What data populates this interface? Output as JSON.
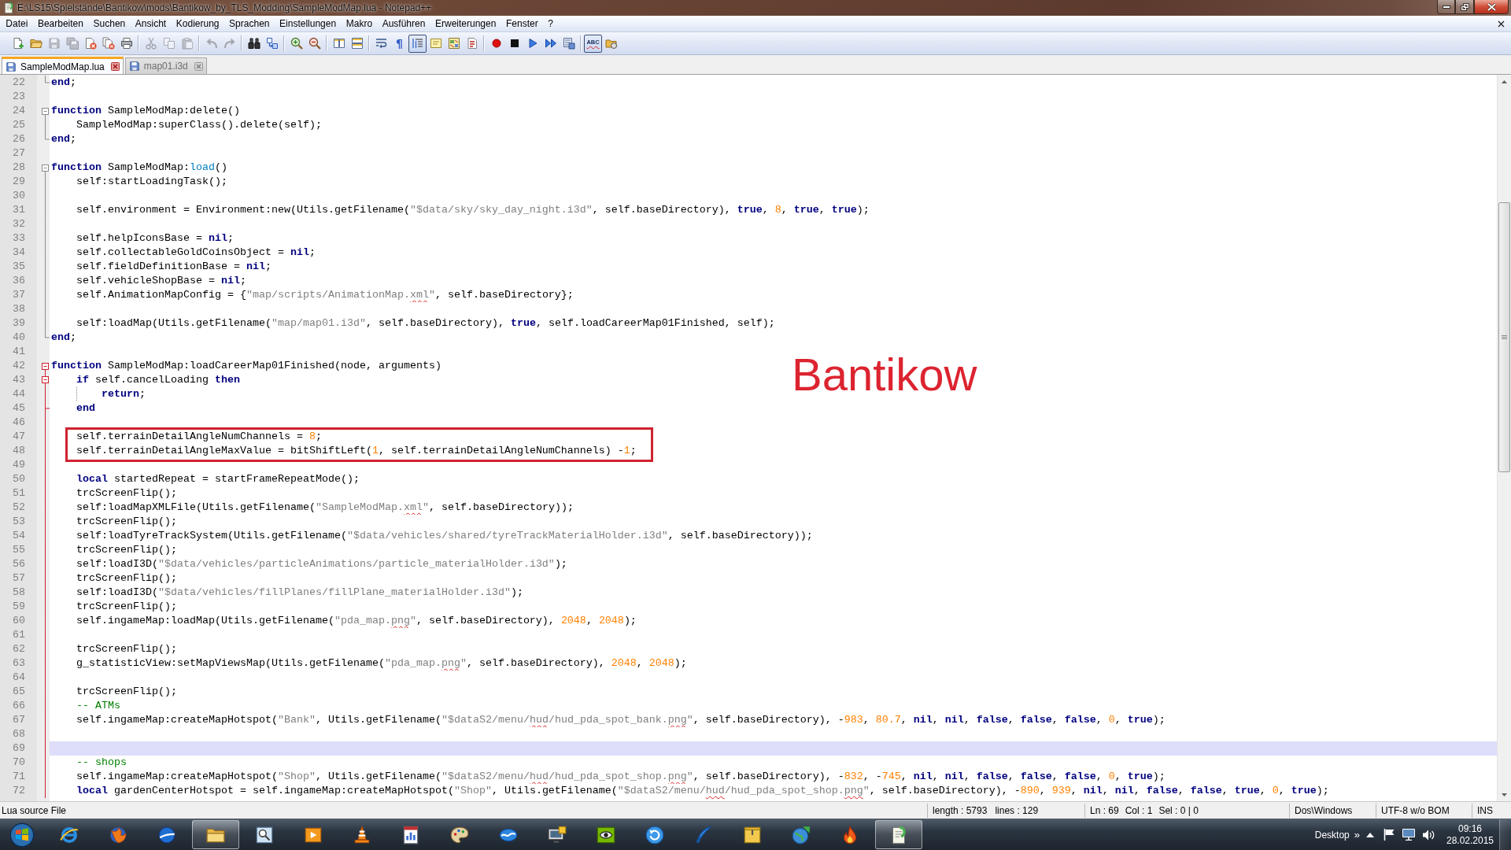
{
  "window": {
    "title": "E:\\LS15\\Spielstände\\Bantikow\\mods\\Bantikow_by_TLS_Modding\\SampleModMap.lua - Notepad++"
  },
  "menu": [
    "Datei",
    "Bearbeiten",
    "Suchen",
    "Ansicht",
    "Kodierung",
    "Sprachen",
    "Einstellungen",
    "Makro",
    "Ausführen",
    "Erweiterungen",
    "Fenster",
    "?"
  ],
  "toolbar": {
    "groups": [
      [
        {
          "kind": "new",
          "on": false,
          "disabled": false
        },
        {
          "kind": "open",
          "on": false,
          "disabled": false
        },
        {
          "kind": "save",
          "on": false,
          "disabled": true
        },
        {
          "kind": "saveall",
          "on": false,
          "disabled": true
        },
        {
          "kind": "close",
          "on": false,
          "disabled": false
        },
        {
          "kind": "closeall",
          "on": false,
          "disabled": false
        },
        {
          "kind": "print",
          "on": false,
          "disabled": false
        }
      ],
      [
        {
          "kind": "cut",
          "on": false,
          "disabled": true
        },
        {
          "kind": "copy",
          "on": false,
          "disabled": true
        },
        {
          "kind": "paste",
          "on": false,
          "disabled": true
        }
      ],
      [
        {
          "kind": "undo",
          "on": false,
          "disabled": true
        },
        {
          "kind": "redo",
          "on": false,
          "disabled": true
        }
      ],
      [
        {
          "kind": "find",
          "on": false,
          "disabled": false
        },
        {
          "kind": "replace",
          "on": false,
          "disabled": false
        }
      ],
      [
        {
          "kind": "zoomin",
          "on": false,
          "disabled": false
        },
        {
          "kind": "zoomout",
          "on": false,
          "disabled": false
        }
      ],
      [
        {
          "kind": "syncv",
          "on": false,
          "disabled": false
        },
        {
          "kind": "synch",
          "on": false,
          "disabled": false
        }
      ],
      [
        {
          "kind": "wrap",
          "on": false,
          "disabled": false
        },
        {
          "kind": "glyph",
          "glyph": "¶",
          "on": false,
          "disabled": false
        },
        {
          "kind": "indentguide",
          "on": true,
          "disabled": false
        },
        {
          "kind": "udl",
          "on": false,
          "disabled": false
        },
        {
          "kind": "docmap",
          "on": false,
          "disabled": false
        },
        {
          "kind": "funclist",
          "on": false,
          "disabled": false
        }
      ],
      [
        {
          "kind": "record",
          "on": false,
          "disabled": false
        },
        {
          "kind": "stop",
          "on": false,
          "disabled": false
        },
        {
          "kind": "play",
          "on": false,
          "disabled": false
        },
        {
          "kind": "playmulti",
          "on": false,
          "disabled": false
        },
        {
          "kind": "savemacro",
          "on": false,
          "disabled": false
        }
      ],
      [
        {
          "kind": "spell",
          "label": "ABC",
          "on": true,
          "disabled": false
        },
        {
          "kind": "spellfolder",
          "on": false,
          "disabled": false
        }
      ]
    ]
  },
  "tabs": [
    {
      "label": "SampleModMap.lua",
      "selected": true
    },
    {
      "label": "map01.i3d",
      "selected": false
    }
  ],
  "editor": {
    "lines": [
      {
        "number": "22",
        "kind": "tail",
        "fold_active": false,
        "current": false,
        "boxed": false,
        "indent_guide": false,
        "segments": [
          {
            "kind": "keyword",
            "text": "end"
          },
          {
            "kind": "plain",
            "text": ";"
          }
        ]
      },
      {
        "number": "23",
        "kind": "none",
        "current": false,
        "boxed": false,
        "indent_guide": false
      },
      {
        "number": "24",
        "kind": "head",
        "fold_active": false,
        "current": false,
        "boxed": false,
        "indent_guide": false,
        "segments": [
          {
            "kind": "keyword",
            "text": "function"
          },
          {
            "kind": "plain",
            "text": " SampleModMap:delete()"
          }
        ]
      },
      {
        "number": "25",
        "kind": "body",
        "fold_active": false,
        "current": false,
        "boxed": false,
        "indent_guide": false,
        "segments": [
          {
            "kind": "plain",
            "text": "    SampleModMap:superClass().delete(self);"
          }
        ]
      },
      {
        "number": "26",
        "kind": "tail",
        "fold_active": false,
        "current": false,
        "boxed": false,
        "indent_guide": false,
        "segments": [
          {
            "kind": "keyword",
            "text": "end"
          },
          {
            "kind": "plain",
            "text": ";"
          }
        ]
      },
      {
        "number": "27",
        "kind": "none",
        "current": false,
        "boxed": false,
        "indent_guide": false
      },
      {
        "number": "28",
        "kind": "head",
        "fold_active": false,
        "current": false,
        "boxed": false,
        "indent_guide": false,
        "segments": [
          {
            "kind": "keyword",
            "text": "function"
          },
          {
            "kind": "plain",
            "text": " SampleModMap:"
          },
          {
            "kind": "builtin",
            "text": "load"
          },
          {
            "kind": "plain",
            "text": "()"
          }
        ]
      },
      {
        "number": "29",
        "kind": "body",
        "fold_active": false,
        "current": false,
        "boxed": false,
        "indent_guide": false,
        "segments": [
          {
            "kind": "plain",
            "text": "    self:startLoadingTask();"
          }
        ]
      },
      {
        "number": "30",
        "kind": "body",
        "fold_active": false,
        "current": false,
        "boxed": false,
        "indent_guide": false
      },
      {
        "number": "31",
        "kind": "body",
        "fold_active": false,
        "current": false,
        "boxed": false,
        "indent_guide": false,
        "segments": [
          {
            "kind": "plain",
            "text": "    self.environment = Environment:new(Utils.getFilename("
          },
          {
            "kind": "string",
            "text": "\"$data/sky/sky_day_night.i3d\""
          },
          {
            "kind": "plain",
            "text": ", self.baseDirectory), "
          },
          {
            "kind": "keyword",
            "text": "true"
          },
          {
            "kind": "plain",
            "text": ", "
          },
          {
            "kind": "number",
            "text": "8"
          },
          {
            "kind": "plain",
            "text": ", "
          },
          {
            "kind": "keyword",
            "text": "true"
          },
          {
            "kind": "plain",
            "text": ", "
          },
          {
            "kind": "keyword",
            "text": "true"
          },
          {
            "kind": "plain",
            "text": ");"
          }
        ]
      },
      {
        "number": "32",
        "kind": "body",
        "fold_active": false,
        "current": false,
        "boxed": false,
        "indent_guide": false
      },
      {
        "number": "33",
        "kind": "body",
        "fold_active": false,
        "current": false,
        "boxed": false,
        "indent_guide": false,
        "segments": [
          {
            "kind": "plain",
            "text": "    self.helpIconsBase = "
          },
          {
            "kind": "keyword",
            "text": "nil"
          },
          {
            "kind": "plain",
            "text": ";"
          }
        ]
      },
      {
        "number": "34",
        "kind": "body",
        "fold_active": false,
        "current": false,
        "boxed": false,
        "indent_guide": false,
        "segments": [
          {
            "kind": "plain",
            "text": "    self.collectableGoldCoinsObject = "
          },
          {
            "kind": "keyword",
            "text": "nil"
          },
          {
            "kind": "plain",
            "text": ";"
          }
        ]
      },
      {
        "number": "35",
        "kind": "body",
        "fold_active": false,
        "current": false,
        "boxed": false,
        "indent_guide": false,
        "segments": [
          {
            "kind": "plain",
            "text": "    self.fieldDefinitionBase = "
          },
          {
            "kind": "keyword",
            "text": "nil"
          },
          {
            "kind": "plain",
            "text": ";"
          }
        ]
      },
      {
        "number": "36",
        "kind": "body",
        "fold_active": false,
        "current": false,
        "boxed": false,
        "indent_guide": false,
        "segments": [
          {
            "kind": "plain",
            "text": "    self.vehicleShopBase = "
          },
          {
            "kind": "keyword",
            "text": "nil"
          },
          {
            "kind": "plain",
            "text": ";"
          }
        ]
      },
      {
        "number": "37",
        "kind": "body",
        "fold_active": false,
        "current": false,
        "boxed": false,
        "indent_guide": false,
        "segments": [
          {
            "kind": "plain",
            "text": "    self.AnimationMapConfig = {"
          },
          {
            "kind": "string",
            "text": "\"map/scripts/AnimationMap."
          },
          {
            "kind": "typo",
            "text": "xml"
          },
          {
            "kind": "string",
            "text": "\""
          },
          {
            "kind": "plain",
            "text": ", self.baseDirectory};"
          }
        ]
      },
      {
        "number": "38",
        "kind": "body",
        "fold_active": false,
        "current": false,
        "boxed": false,
        "indent_guide": false
      },
      {
        "number": "39",
        "kind": "body",
        "fold_active": false,
        "current": false,
        "boxed": false,
        "indent_guide": false,
        "segments": [
          {
            "kind": "plain",
            "text": "    self:loadMap(Utils.getFilename("
          },
          {
            "kind": "string",
            "text": "\"map/map01.i3d\""
          },
          {
            "kind": "plain",
            "text": ", self.baseDirectory), "
          },
          {
            "kind": "keyword",
            "text": "true"
          },
          {
            "kind": "plain",
            "text": ", self.loadCareerMap01Finished, self);"
          }
        ]
      },
      {
        "number": "40",
        "kind": "tail",
        "fold_active": false,
        "current": false,
        "boxed": false,
        "indent_guide": false,
        "segments": [
          {
            "kind": "keyword",
            "text": "end"
          },
          {
            "kind": "plain",
            "text": ";"
          }
        ]
      },
      {
        "number": "41",
        "kind": "none",
        "current": false,
        "boxed": false,
        "indent_guide": false
      },
      {
        "number": "42",
        "kind": "head",
        "fold_active": true,
        "current": false,
        "boxed": false,
        "indent_guide": false,
        "segments": [
          {
            "kind": "keyword",
            "text": "function"
          },
          {
            "kind": "plain",
            "text": " SampleModMap:loadCareerMap01Finished(node, arguments)"
          }
        ]
      },
      {
        "number": "43",
        "kind": "subhead",
        "fold_active": true,
        "current": false,
        "boxed": false,
        "indent_guide": false,
        "segments": [
          {
            "kind": "keyword",
            "text": "    if"
          },
          {
            "kind": "plain",
            "text": " self.cancelLoading "
          },
          {
            "kind": "keyword",
            "text": "then"
          }
        ]
      },
      {
        "number": "44",
        "kind": "body",
        "fold_active": true,
        "current": false,
        "boxed": false,
        "indent_guide": true,
        "segments": [
          {
            "kind": "keyword",
            "text": "        return"
          },
          {
            "kind": "plain",
            "text": ";"
          }
        ]
      },
      {
        "number": "45",
        "kind": "branch",
        "fold_active": true,
        "current": false,
        "boxed": false,
        "indent_guide": false,
        "segments": [
          {
            "kind": "keyword",
            "text": "    end"
          }
        ]
      },
      {
        "number": "46",
        "kind": "body",
        "fold_active": true,
        "current": false,
        "boxed": false,
        "indent_guide": false
      },
      {
        "number": "47",
        "kind": "body",
        "fold_active": true,
        "current": false,
        "boxed": true,
        "indent_guide": false,
        "segments": [
          {
            "kind": "plain",
            "text": "    self.terrainDetailAngleNumChannels = "
          },
          {
            "kind": "number",
            "text": "8"
          },
          {
            "kind": "plain",
            "text": ";"
          }
        ]
      },
      {
        "number": "48",
        "kind": "body",
        "fold_active": true,
        "current": false,
        "boxed": true,
        "indent_guide": false,
        "segments": [
          {
            "kind": "plain",
            "text": "    self.terrainDetailAngleMaxValue = bitShiftLeft("
          },
          {
            "kind": "number",
            "text": "1"
          },
          {
            "kind": "plain",
            "text": ", self.terrainDetailAngleNumChannels) -"
          },
          {
            "kind": "number",
            "text": "1"
          },
          {
            "kind": "plain",
            "text": ";"
          }
        ]
      },
      {
        "number": "49",
        "kind": "body",
        "fold_active": true,
        "current": false,
        "boxed": false,
        "indent_guide": false
      },
      {
        "number": "50",
        "kind": "body",
        "fold_active": true,
        "current": false,
        "boxed": false,
        "indent_guide": false,
        "segments": [
          {
            "kind": "keyword",
            "text": "    local"
          },
          {
            "kind": "plain",
            "text": " startedRepeat = startFrameRepeatMode();"
          }
        ]
      },
      {
        "number": "51",
        "kind": "body",
        "fold_active": true,
        "current": false,
        "boxed": false,
        "indent_guide": false,
        "segments": [
          {
            "kind": "plain",
            "text": "    trcScreenFlip();"
          }
        ]
      },
      {
        "number": "52",
        "kind": "body",
        "fold_active": true,
        "current": false,
        "boxed": false,
        "indent_guide": false,
        "segments": [
          {
            "kind": "plain",
            "text": "    self:loadMapXMLFile(Utils.getFilename("
          },
          {
            "kind": "string",
            "text": "\"SampleModMap."
          },
          {
            "kind": "typo",
            "text": "xml"
          },
          {
            "kind": "string",
            "text": "\""
          },
          {
            "kind": "plain",
            "text": ", self.baseDirectory));"
          }
        ]
      },
      {
        "number": "53",
        "kind": "body",
        "fold_active": true,
        "current": false,
        "boxed": false,
        "indent_guide": false,
        "segments": [
          {
            "kind": "plain",
            "text": "    trcScreenFlip();"
          }
        ]
      },
      {
        "number": "54",
        "kind": "body",
        "fold_active": true,
        "current": false,
        "boxed": false,
        "indent_guide": false,
        "segments": [
          {
            "kind": "plain",
            "text": "    self:loadTyreTrackSystem(Utils.getFilename("
          },
          {
            "kind": "string",
            "text": "\"$data/vehicles/shared/tyreTrackMaterialHolder.i3d\""
          },
          {
            "kind": "plain",
            "text": ", self.baseDirectory));"
          }
        ]
      },
      {
        "number": "55",
        "kind": "body",
        "fold_active": true,
        "current": false,
        "boxed": false,
        "indent_guide": false,
        "segments": [
          {
            "kind": "plain",
            "text": "    trcScreenFlip();"
          }
        ]
      },
      {
        "number": "56",
        "kind": "body",
        "fold_active": true,
        "current": false,
        "boxed": false,
        "indent_guide": false,
        "segments": [
          {
            "kind": "plain",
            "text": "    self:loadI3D("
          },
          {
            "kind": "string",
            "text": "\"$data/vehicles/particleAnimations/particle_materialHolder.i3d\""
          },
          {
            "kind": "plain",
            "text": ");"
          }
        ]
      },
      {
        "number": "57",
        "kind": "body",
        "fold_active": true,
        "current": false,
        "boxed": false,
        "indent_guide": false,
        "segments": [
          {
            "kind": "plain",
            "text": "    trcScreenFlip();"
          }
        ]
      },
      {
        "number": "58",
        "kind": "body",
        "fold_active": true,
        "current": false,
        "boxed": false,
        "indent_guide": false,
        "segments": [
          {
            "kind": "plain",
            "text": "    self:loadI3D("
          },
          {
            "kind": "string",
            "text": "\"$data/vehicles/fillPlanes/fillPlane_materialHolder.i3d\""
          },
          {
            "kind": "plain",
            "text": ");"
          }
        ]
      },
      {
        "number": "59",
        "kind": "body",
        "fold_active": true,
        "current": false,
        "boxed": false,
        "indent_guide": false,
        "segments": [
          {
            "kind": "plain",
            "text": "    trcScreenFlip();"
          }
        ]
      },
      {
        "number": "60",
        "kind": "body",
        "fold_active": true,
        "current": false,
        "boxed": false,
        "indent_guide": false,
        "segments": [
          {
            "kind": "plain",
            "text": "    self.ingameMap:loadMap(Utils.getFilename("
          },
          {
            "kind": "string",
            "text": "\"pda_map."
          },
          {
            "kind": "typo",
            "text": "png"
          },
          {
            "kind": "string",
            "text": "\""
          },
          {
            "kind": "plain",
            "text": ", self.baseDirectory), "
          },
          {
            "kind": "number",
            "text": "2048"
          },
          {
            "kind": "plain",
            "text": ", "
          },
          {
            "kind": "number",
            "text": "2048"
          },
          {
            "kind": "plain",
            "text": ");"
          }
        ]
      },
      {
        "number": "61",
        "kind": "body",
        "fold_active": true,
        "current": false,
        "boxed": false,
        "indent_guide": false
      },
      {
        "number": "62",
        "kind": "body",
        "fold_active": true,
        "current": false,
        "boxed": false,
        "indent_guide": false,
        "segments": [
          {
            "kind": "plain",
            "text": "    trcScreenFlip();"
          }
        ]
      },
      {
        "number": "63",
        "kind": "body",
        "fold_active": true,
        "current": false,
        "boxed": false,
        "indent_guide": false,
        "segments": [
          {
            "kind": "plain",
            "text": "    g_statisticView:setMapViewsMap(Utils.getFilename("
          },
          {
            "kind": "string",
            "text": "\"pda_map."
          },
          {
            "kind": "typo",
            "text": "png"
          },
          {
            "kind": "string",
            "text": "\""
          },
          {
            "kind": "plain",
            "text": ", self.baseDirectory), "
          },
          {
            "kind": "number",
            "text": "2048"
          },
          {
            "kind": "plain",
            "text": ", "
          },
          {
            "kind": "number",
            "text": "2048"
          },
          {
            "kind": "plain",
            "text": ");"
          }
        ]
      },
      {
        "number": "64",
        "kind": "body",
        "fold_active": true,
        "current": false,
        "boxed": false,
        "indent_guide": false
      },
      {
        "number": "65",
        "kind": "body",
        "fold_active": true,
        "current": false,
        "boxed": false,
        "indent_guide": false,
        "segments": [
          {
            "kind": "plain",
            "text": "    trcScreenFlip();"
          }
        ]
      },
      {
        "number": "66",
        "kind": "body",
        "fold_active": true,
        "current": false,
        "boxed": false,
        "indent_guide": false,
        "segments": [
          {
            "kind": "comment",
            "text": "    -- ATMs"
          }
        ]
      },
      {
        "number": "67",
        "kind": "body",
        "fold_active": true,
        "current": false,
        "boxed": false,
        "indent_guide": false,
        "segments": [
          {
            "kind": "plain",
            "text": "    self.ingameMap:createMapHotspot("
          },
          {
            "kind": "string",
            "text": "\"Bank\""
          },
          {
            "kind": "plain",
            "text": ", Utils.getFilename("
          },
          {
            "kind": "string",
            "text": "\"$dataS2/menu/"
          },
          {
            "kind": "typo",
            "text": "hud"
          },
          {
            "kind": "string",
            "text": "/hud_pda_spot_bank."
          },
          {
            "kind": "typo",
            "text": "png"
          },
          {
            "kind": "string",
            "text": "\""
          },
          {
            "kind": "plain",
            "text": ", self.baseDirectory), -"
          },
          {
            "kind": "number",
            "text": "983"
          },
          {
            "kind": "plain",
            "text": ", "
          },
          {
            "kind": "number",
            "text": "80.7"
          },
          {
            "kind": "plain",
            "text": ", "
          },
          {
            "kind": "keyword",
            "text": "nil"
          },
          {
            "kind": "plain",
            "text": ", "
          },
          {
            "kind": "keyword",
            "text": "nil"
          },
          {
            "kind": "plain",
            "text": ", "
          },
          {
            "kind": "keyword",
            "text": "false"
          },
          {
            "kind": "plain",
            "text": ", "
          },
          {
            "kind": "keyword",
            "text": "false"
          },
          {
            "kind": "plain",
            "text": ", "
          },
          {
            "kind": "keyword",
            "text": "false"
          },
          {
            "kind": "plain",
            "text": ", "
          },
          {
            "kind": "number",
            "text": "0"
          },
          {
            "kind": "plain",
            "text": ", "
          },
          {
            "kind": "keyword",
            "text": "true"
          },
          {
            "kind": "plain",
            "text": ");"
          }
        ]
      },
      {
        "number": "68",
        "kind": "body",
        "fold_active": true,
        "current": false,
        "boxed": false,
        "indent_guide": false
      },
      {
        "number": "69",
        "kind": "body",
        "fold_active": true,
        "current": true,
        "boxed": false,
        "indent_guide": false
      },
      {
        "number": "70",
        "kind": "body",
        "fold_active": true,
        "current": false,
        "boxed": false,
        "indent_guide": false,
        "segments": [
          {
            "kind": "comment",
            "text": "    -- shops"
          }
        ]
      },
      {
        "number": "71",
        "kind": "body",
        "fold_active": true,
        "current": false,
        "boxed": false,
        "indent_guide": false,
        "segments": [
          {
            "kind": "plain",
            "text": "    self.ingameMap:createMapHotspot("
          },
          {
            "kind": "string",
            "text": "\"Shop\""
          },
          {
            "kind": "plain",
            "text": ", Utils.getFilename("
          },
          {
            "kind": "string",
            "text": "\"$dataS2/menu/"
          },
          {
            "kind": "typo",
            "text": "hud"
          },
          {
            "kind": "string",
            "text": "/hud_pda_spot_shop."
          },
          {
            "kind": "typo",
            "text": "png"
          },
          {
            "kind": "string",
            "text": "\""
          },
          {
            "kind": "plain",
            "text": ", self.baseDirectory), -"
          },
          {
            "kind": "number",
            "text": "832"
          },
          {
            "kind": "plain",
            "text": ", -"
          },
          {
            "kind": "number",
            "text": "745"
          },
          {
            "kind": "plain",
            "text": ", "
          },
          {
            "kind": "keyword",
            "text": "nil"
          },
          {
            "kind": "plain",
            "text": ", "
          },
          {
            "kind": "keyword",
            "text": "nil"
          },
          {
            "kind": "plain",
            "text": ", "
          },
          {
            "kind": "keyword",
            "text": "false"
          },
          {
            "kind": "plain",
            "text": ", "
          },
          {
            "kind": "keyword",
            "text": "false"
          },
          {
            "kind": "plain",
            "text": ", "
          },
          {
            "kind": "keyword",
            "text": "false"
          },
          {
            "kind": "plain",
            "text": ", "
          },
          {
            "kind": "number",
            "text": "0"
          },
          {
            "kind": "plain",
            "text": ", "
          },
          {
            "kind": "keyword",
            "text": "true"
          },
          {
            "kind": "plain",
            "text": ");"
          }
        ]
      },
      {
        "number": "72",
        "kind": "body",
        "fold_active": true,
        "current": false,
        "boxed": false,
        "indent_guide": false,
        "segments": [
          {
            "kind": "keyword",
            "text": "    local"
          },
          {
            "kind": "plain",
            "text": " gardenCenterHotspot = self.ingameMap:createMapHotspot("
          },
          {
            "kind": "string",
            "text": "\"Shop\""
          },
          {
            "kind": "plain",
            "text": ", Utils.getFilename("
          },
          {
            "kind": "string",
            "text": "\"$dataS2/menu/"
          },
          {
            "kind": "typo",
            "text": "hud"
          },
          {
            "kind": "string",
            "text": "/hud_pda_spot_shop."
          },
          {
            "kind": "typo",
            "text": "png"
          },
          {
            "kind": "string",
            "text": "\""
          },
          {
            "kind": "plain",
            "text": ", self.baseDirectory), -"
          },
          {
            "kind": "number",
            "text": "890"
          },
          {
            "kind": "plain",
            "text": ", "
          },
          {
            "kind": "number",
            "text": "939"
          },
          {
            "kind": "plain",
            "text": ", "
          },
          {
            "kind": "keyword",
            "text": "nil"
          },
          {
            "kind": "plain",
            "text": ", "
          },
          {
            "kind": "keyword",
            "text": "nil"
          },
          {
            "kind": "plain",
            "text": ", "
          },
          {
            "kind": "keyword",
            "text": "false"
          },
          {
            "kind": "plain",
            "text": ", "
          },
          {
            "kind": "keyword",
            "text": "false"
          },
          {
            "kind": "plain",
            "text": ", "
          },
          {
            "kind": "keyword",
            "text": "true"
          },
          {
            "kind": "plain",
            "text": ", "
          },
          {
            "kind": "number",
            "text": "0"
          },
          {
            "kind": "plain",
            "text": ", "
          },
          {
            "kind": "keyword",
            "text": "true"
          },
          {
            "kind": "plain",
            "text": ");"
          }
        ]
      }
    ]
  },
  "annotation": {
    "label": "Bantikow"
  },
  "status_bar": {
    "file_type": "Lua source File",
    "document": [
      "length : 5793",
      "lines : 129"
    ],
    "position": [
      "Ln : 69",
      "Col : 1",
      "Sel : 0 | 0"
    ],
    "eol": "Dos\\Windows",
    "encoding": "UTF-8 w/o BOM",
    "mode": "INS"
  },
  "taskbar": {
    "apps": [
      {
        "kind": "ring",
        "running": false
      },
      {
        "kind": "flameglobe",
        "running": false
      },
      {
        "kind": "swooshglobe",
        "running": false
      },
      {
        "kind": "folder",
        "running": true
      },
      {
        "kind": "magnifier",
        "running": false
      },
      {
        "kind": "player",
        "running": false
      },
      {
        "kind": "cone",
        "running": false
      },
      {
        "kind": "chart",
        "running": false
      },
      {
        "kind": "palette",
        "running": false
      },
      {
        "kind": "wave",
        "running": false
      },
      {
        "kind": "monitor",
        "running": false
      },
      {
        "kind": "eye",
        "running": false
      },
      {
        "kind": "refresh",
        "running": false
      },
      {
        "kind": "feather",
        "running": false
      },
      {
        "kind": "archive",
        "running": false
      },
      {
        "kind": "globearrow",
        "running": false
      },
      {
        "kind": "flame",
        "running": false
      },
      {
        "kind": "notepad",
        "running": true
      }
    ],
    "desktop_label": "Desktop",
    "chevron": "»",
    "clock": {
      "time": "09:16",
      "date": "28.02.2015"
    }
  }
}
